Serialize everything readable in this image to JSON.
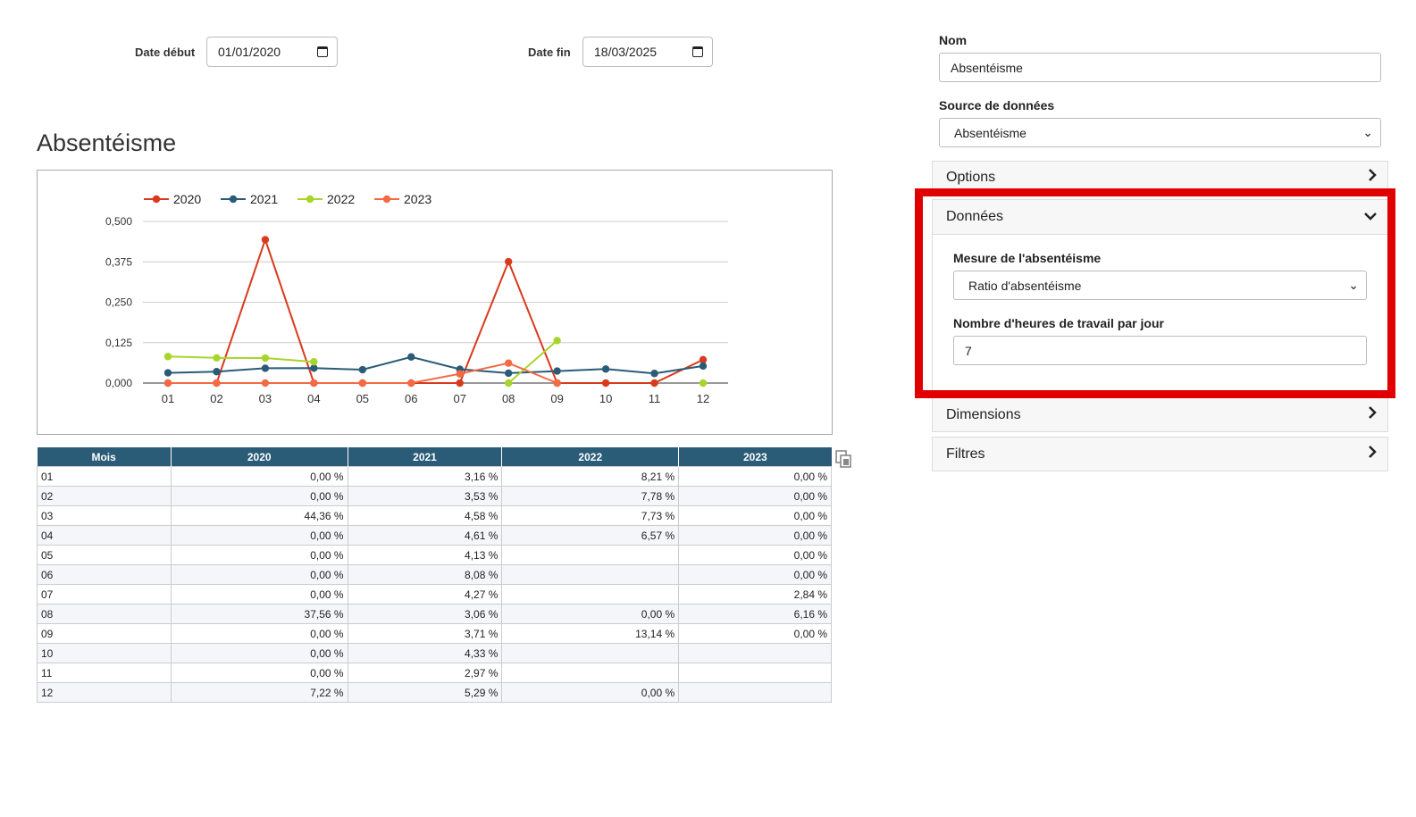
{
  "filters": {
    "date_debut_label": "Date début",
    "date_debut_value": "01/01/2020",
    "date_fin_label": "Date fin",
    "date_fin_value": "18/03/2025"
  },
  "title": "Absentéisme",
  "chart_data": {
    "type": "line",
    "categories": [
      "01",
      "02",
      "03",
      "04",
      "05",
      "06",
      "07",
      "08",
      "09",
      "10",
      "11",
      "12"
    ],
    "ylim": [
      0,
      0.5
    ],
    "yticks": [
      "0,500",
      "0,375",
      "0,250",
      "0,125",
      "0,000"
    ],
    "legend_position": "top-left",
    "grid": true,
    "series": [
      {
        "name": "2020",
        "color": "#d93a1d",
        "values": [
          0,
          0,
          0.4436,
          0,
          0,
          0,
          0,
          0.3756,
          0,
          0,
          0,
          0.0722
        ]
      },
      {
        "name": "2021",
        "color": "#2a5b77",
        "values": [
          0.0316,
          0.0353,
          0.0458,
          0.0461,
          0.0413,
          0.0808,
          0.0427,
          0.0306,
          0.0371,
          0.0433,
          0.0297,
          0.0529
        ]
      },
      {
        "name": "2022",
        "color": "#a8d52b",
        "values": [
          0.0821,
          0.0778,
          0.0773,
          0.0657,
          null,
          null,
          null,
          0,
          0.1314,
          null,
          null,
          0
        ]
      },
      {
        "name": "2023",
        "color": "#f46b43",
        "values": [
          0,
          0,
          0,
          0,
          0,
          0,
          0.0284,
          0.0616,
          0,
          null,
          null,
          null
        ]
      }
    ]
  },
  "table": {
    "headers": [
      "Mois",
      "2020",
      "2021",
      "2022",
      "2023"
    ],
    "rows": [
      [
        "01",
        "0,00 %",
        "3,16 %",
        "8,21 %",
        "0,00 %"
      ],
      [
        "02",
        "0,00 %",
        "3,53 %",
        "7,78 %",
        "0,00 %"
      ],
      [
        "03",
        "44,36 %",
        "4,58 %",
        "7,73 %",
        "0,00 %"
      ],
      [
        "04",
        "0,00 %",
        "4,61 %",
        "6,57 %",
        "0,00 %"
      ],
      [
        "05",
        "0,00 %",
        "4,13 %",
        "",
        "0,00 %"
      ],
      [
        "06",
        "0,00 %",
        "8,08 %",
        "",
        "0,00 %"
      ],
      [
        "07",
        "0,00 %",
        "4,27 %",
        "",
        "2,84 %"
      ],
      [
        "08",
        "37,56 %",
        "3,06 %",
        "0,00 %",
        "6,16 %"
      ],
      [
        "09",
        "0,00 %",
        "3,71 %",
        "13,14 %",
        "0,00 %"
      ],
      [
        "10",
        "0,00 %",
        "4,33 %",
        "",
        ""
      ],
      [
        "11",
        "0,00 %",
        "2,97 %",
        "",
        ""
      ],
      [
        "12",
        "7,22 %",
        "5,29 %",
        "0,00 %",
        ""
      ]
    ]
  },
  "sidebar": {
    "nom_label": "Nom",
    "nom_value": "Absentéisme",
    "source_label": "Source de données",
    "source_value": "Absentéisme",
    "sections": {
      "options": "Options",
      "donnees": "Données",
      "dimensions": "Dimensions",
      "filtres": "Filtres"
    },
    "donnees": {
      "mesure_label": "Mesure de l'absentéisme",
      "mesure_value": "Ratio d'absentéisme",
      "heures_label": "Nombre d'heures de travail par jour",
      "heures_value": "7"
    }
  },
  "colors": {
    "highlight": "#e00000",
    "table_header": "#2a5b77"
  }
}
